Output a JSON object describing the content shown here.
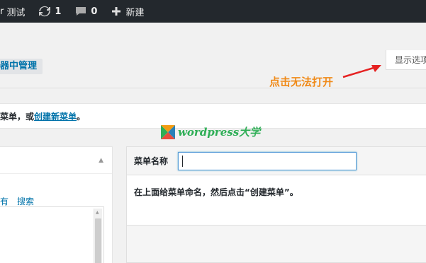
{
  "admin_bar": {
    "site_fragment": "r",
    "site_name": "测试",
    "updates_count": "1",
    "comments_count": "0",
    "new_label": "新建"
  },
  "header": {
    "manage_link": "器中管理",
    "screen_options": "显示选项"
  },
  "annotation": {
    "text": "点击无法打开",
    "color": "#f08a18"
  },
  "notice": {
    "prefix": "菜单，或",
    "link": "创建新菜单",
    "suffix": "。"
  },
  "watermark": {
    "text": "wordpress大学",
    "color": "#2eae56"
  },
  "left_panel": {
    "tabs": [
      "有",
      "搜索"
    ]
  },
  "right_panel": {
    "name_label": "菜单名称",
    "name_value": "",
    "instruction": "在上面给菜单命名，然后点击“创建菜单”。"
  },
  "colors": {
    "adminbar": "#23282d",
    "link": "#0073aa"
  }
}
